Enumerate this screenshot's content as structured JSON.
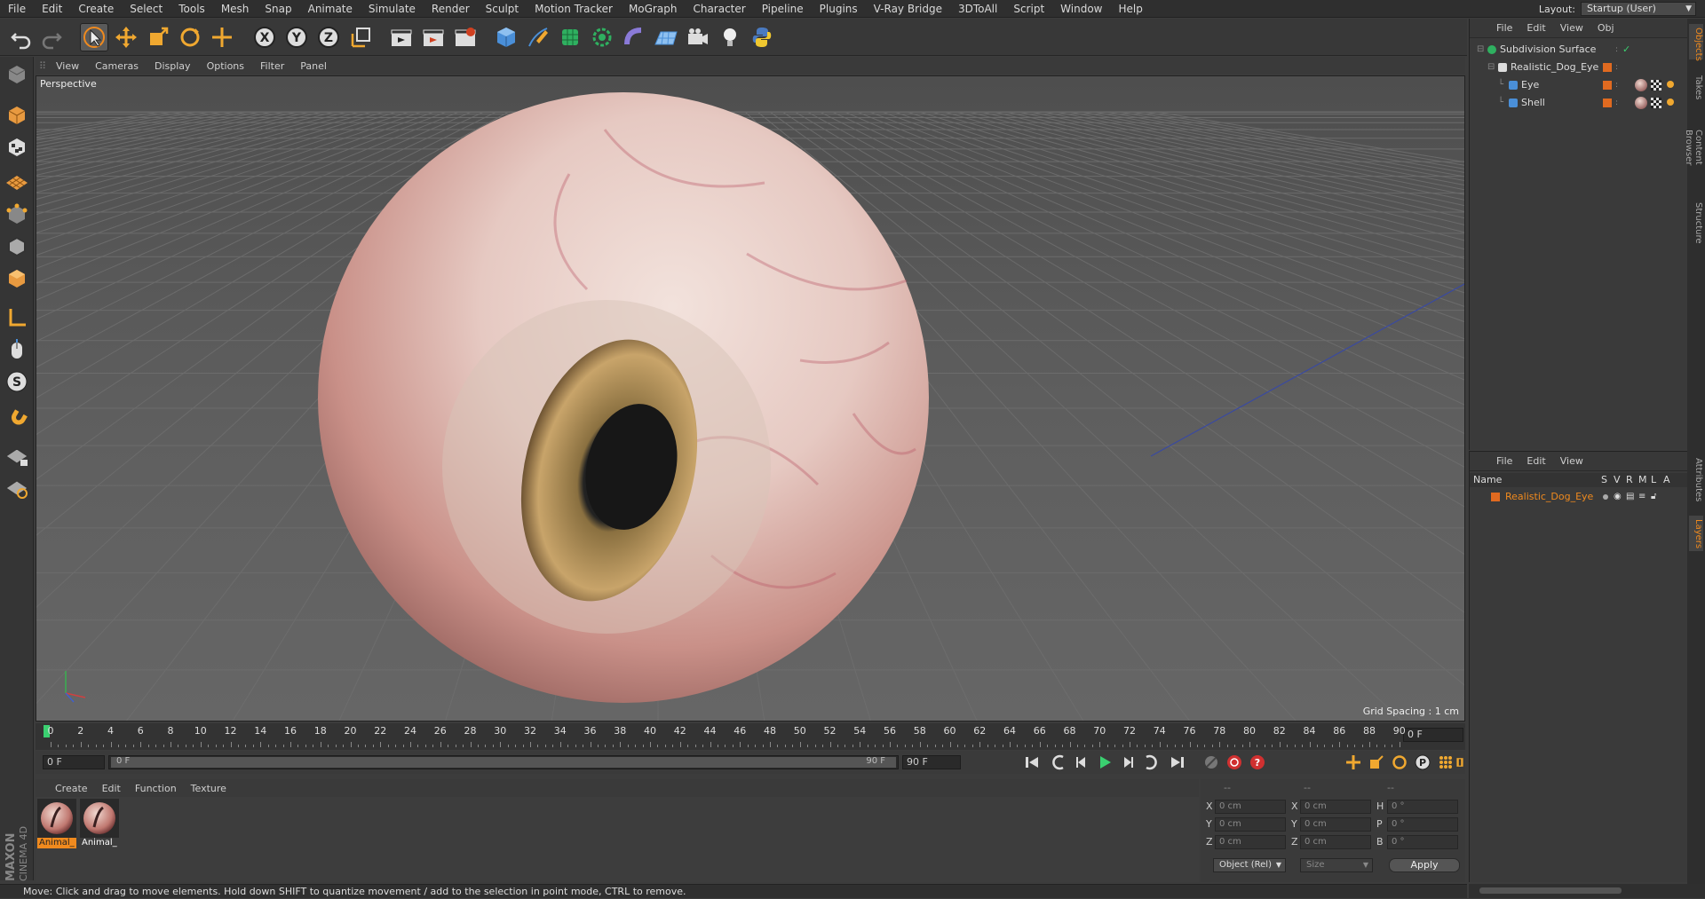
{
  "menu": [
    "File",
    "Edit",
    "Create",
    "Select",
    "Tools",
    "Mesh",
    "Snap",
    "Animate",
    "Simulate",
    "Render",
    "Sculpt",
    "Motion Tracker",
    "MoGraph",
    "Character",
    "Pipeline",
    "Plugins",
    "V-Ray Bridge",
    "3DToAll",
    "Script",
    "Window",
    "Help"
  ],
  "layout": {
    "label": "Layout:",
    "value": "Startup (User)"
  },
  "viewport": {
    "menu": [
      "View",
      "Cameras",
      "Display",
      "Options",
      "Filter",
      "Panel"
    ],
    "label": "Perspective",
    "grid_spacing": "Grid Spacing : 1 cm"
  },
  "timeline": {
    "ticks": [
      "0",
      "2",
      "4",
      "6",
      "8",
      "10",
      "12",
      "14",
      "16",
      "18",
      "20",
      "22",
      "24",
      "26",
      "28",
      "30",
      "32",
      "34",
      "36",
      "38",
      "40",
      "42",
      "44",
      "46",
      "48",
      "50",
      "52",
      "54",
      "56",
      "58",
      "60",
      "62",
      "64",
      "66",
      "68",
      "70",
      "72",
      "74",
      "76",
      "78",
      "80",
      "82",
      "84",
      "86",
      "88",
      "90"
    ],
    "current_frame": "0 F"
  },
  "transport": {
    "start_field": "0 F",
    "range_start": "0 F",
    "range_end": "90 F",
    "end_field": "90 F"
  },
  "materials": {
    "menu": [
      "Create",
      "Edit",
      "Function",
      "Texture"
    ],
    "items": [
      {
        "name": "Animal_",
        "selected": true
      },
      {
        "name": "Animal_",
        "selected": false
      }
    ]
  },
  "coords": {
    "header": [
      "--",
      "--",
      "--"
    ],
    "rows": [
      {
        "a": "X",
        "av": "0 cm",
        "b": "X",
        "bv": "0 cm",
        "c": "H",
        "cv": "0 °"
      },
      {
        "a": "Y",
        "av": "0 cm",
        "b": "Y",
        "bv": "0 cm",
        "c": "P",
        "cv": "0 °"
      },
      {
        "a": "Z",
        "av": "0 cm",
        "b": "Z",
        "bv": "0 cm",
        "c": "B",
        "cv": "0 °"
      }
    ],
    "mode": "Object (Rel)",
    "size": "Size",
    "apply": "Apply"
  },
  "status": "Move: Click and drag to move elements. Hold down SHIFT to quantize movement / add to the selection in point mode, CTRL to remove.",
  "brand": {
    "line1": "MAXON",
    "line2": "CINEMA 4D"
  },
  "object_manager": {
    "menu": [
      "File",
      "Edit",
      "View",
      "Obj"
    ],
    "objects": [
      {
        "name": "Subdivision Surface",
        "indent": 0
      },
      {
        "name": "Realistic_Dog_Eye",
        "indent": 1
      },
      {
        "name": "Eye",
        "indent": 2
      },
      {
        "name": "Shell",
        "indent": 2
      }
    ]
  },
  "layer_manager": {
    "menu": [
      "File",
      "Edit",
      "View"
    ],
    "columns": [
      "Name",
      "S",
      "V",
      "R",
      "M",
      "L",
      "A"
    ],
    "layers": [
      {
        "name": "Realistic_Dog_Eye"
      }
    ]
  },
  "right_tabs": [
    "Objects",
    "Takes",
    "Content Browser",
    "Structure",
    "Attributes",
    "Layers"
  ],
  "colors": {
    "accent": "#f08a1e",
    "selection_blue": "#4a8fd8"
  }
}
